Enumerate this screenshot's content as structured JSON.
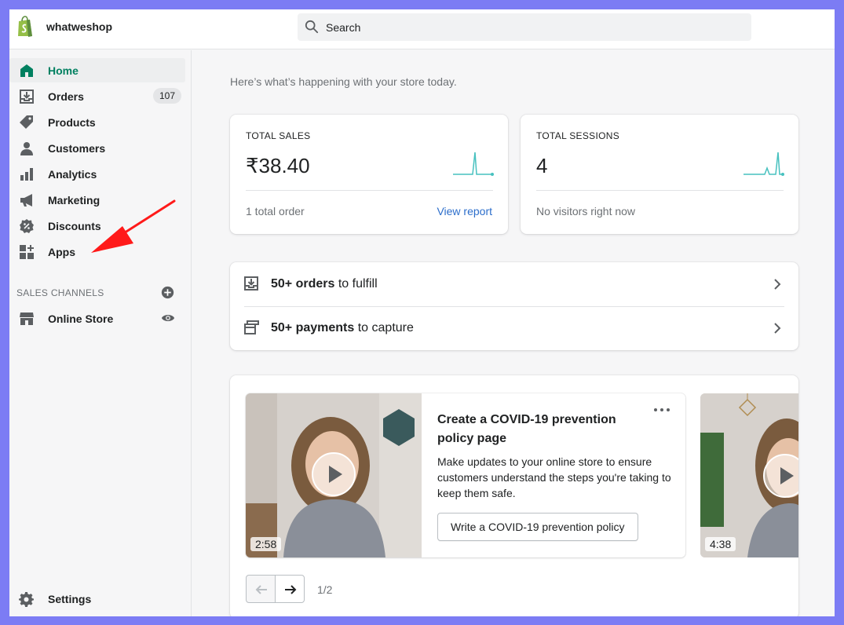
{
  "topbar": {
    "shop_name": "whatweshop",
    "search_placeholder": "Search"
  },
  "sidebar": {
    "items": [
      {
        "label": "Home",
        "icon": "home-icon",
        "active": true
      },
      {
        "label": "Orders",
        "icon": "orders-icon",
        "badge": "107"
      },
      {
        "label": "Products",
        "icon": "tag-icon"
      },
      {
        "label": "Customers",
        "icon": "person-icon"
      },
      {
        "label": "Analytics",
        "icon": "bar-chart-icon"
      },
      {
        "label": "Marketing",
        "icon": "megaphone-icon"
      },
      {
        "label": "Discounts",
        "icon": "discount-icon"
      },
      {
        "label": "Apps",
        "icon": "apps-icon"
      }
    ],
    "sales_channels_title": "SALES CHANNELS",
    "online_store": "Online Store",
    "settings": "Settings"
  },
  "colors": {
    "accent_green": "#008060",
    "link_blue": "#2c6ecb",
    "spark_teal": "#47c1bf",
    "annotation_arrow": "#ff1a1a"
  },
  "main": {
    "greeting": "Here’s what’s happening with your store today.",
    "sales": {
      "title": "TOTAL SALES",
      "value": "₹38.40",
      "footer": "1 total order",
      "link": "View report"
    },
    "sessions": {
      "title": "TOTAL SESSIONS",
      "value": "4",
      "footer": "No visitors right now"
    },
    "tasks": [
      {
        "bold": "50+ orders",
        "rest": " to fulfill",
        "icon": "fulfill-icon"
      },
      {
        "bold": "50+ payments",
        "rest": " to capture",
        "icon": "payment-icon"
      }
    ],
    "video": {
      "duration": "2:58",
      "title": "Create a COVID-19 prevention policy page",
      "description": "Make updates to your online store to ensure customers understand the steps you're taking to keep them safe.",
      "button": "Write a COVID-19 prevention policy",
      "next_duration": "4:38"
    },
    "pager": {
      "count": "1/2"
    }
  }
}
